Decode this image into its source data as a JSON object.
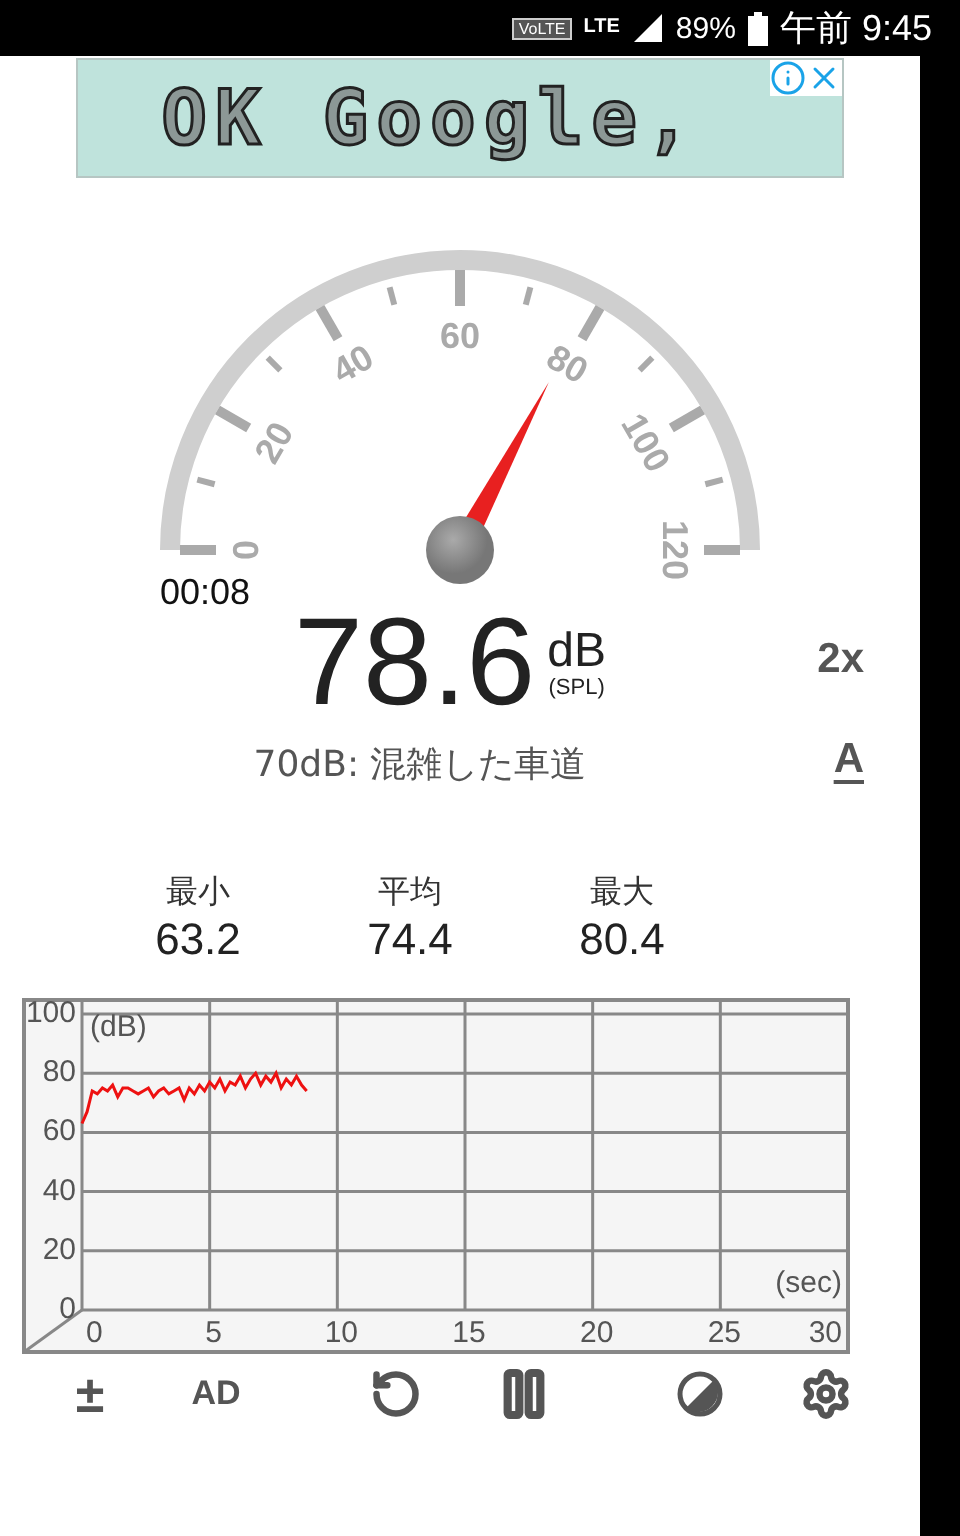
{
  "status_bar": {
    "volte": "VoLTE",
    "network": "LTE",
    "battery": "89%",
    "time": "午前 9:45"
  },
  "ad": {
    "text": "OK Google,"
  },
  "gauge": {
    "ticks": [
      "0",
      "20",
      "40",
      "60",
      "80",
      "100",
      "120"
    ],
    "timer": "00:08"
  },
  "reading": {
    "value": "78.6",
    "unit": "dB",
    "weighting": "(SPL)",
    "speed_button": "2x",
    "caption": "70dB: 混雑した車道",
    "filter_button": "A"
  },
  "stats": [
    {
      "label": "最小",
      "value": "63.2"
    },
    {
      "label": "平均",
      "value": "74.4"
    },
    {
      "label": "最大",
      "value": "80.4"
    }
  ],
  "history": {
    "chart_data": {
      "type": "line",
      "xlabel": "(sec)",
      "ylabel": "(dB)",
      "xlim": [
        0,
        30
      ],
      "ylim": [
        0,
        100
      ],
      "xticks": [
        0,
        5,
        10,
        15,
        20,
        25,
        30
      ],
      "grid": true,
      "yticks": [
        0,
        20,
        40,
        60,
        80,
        100
      ],
      "x": [
        0,
        0.2,
        0.4,
        0.6,
        0.8,
        1,
        1.2,
        1.4,
        1.6,
        1.8,
        2,
        2.2,
        2.4,
        2.6,
        2.8,
        3,
        3.2,
        3.4,
        3.6,
        3.8,
        4,
        4.2,
        4.4,
        4.6,
        4.8,
        5,
        5.2,
        5.4,
        5.6,
        5.8,
        6,
        6.2,
        6.4,
        6.6,
        6.8,
        7,
        7.2,
        7.4,
        7.6,
        7.8,
        8,
        8.2,
        8.4,
        8.6,
        8.8
      ],
      "series": [
        {
          "color": "#ee1111",
          "values": [
            63,
            67,
            74,
            73,
            75,
            74,
            76,
            72,
            75,
            75,
            74,
            73,
            74,
            75,
            72,
            74,
            75,
            73,
            74,
            75,
            71,
            75,
            73,
            76,
            74,
            77,
            75,
            78,
            74,
            77,
            76,
            79,
            75,
            78,
            80,
            76,
            79,
            77,
            80,
            75,
            78,
            76,
            79,
            76,
            74
          ]
        }
      ]
    }
  },
  "toolbar": [
    {
      "kind": "symbol",
      "label": "±"
    },
    {
      "kind": "text",
      "label": "AD"
    },
    {
      "kind": "reset"
    },
    {
      "kind": "pause"
    },
    {
      "kind": "contrast"
    },
    {
      "kind": "settings"
    }
  ]
}
